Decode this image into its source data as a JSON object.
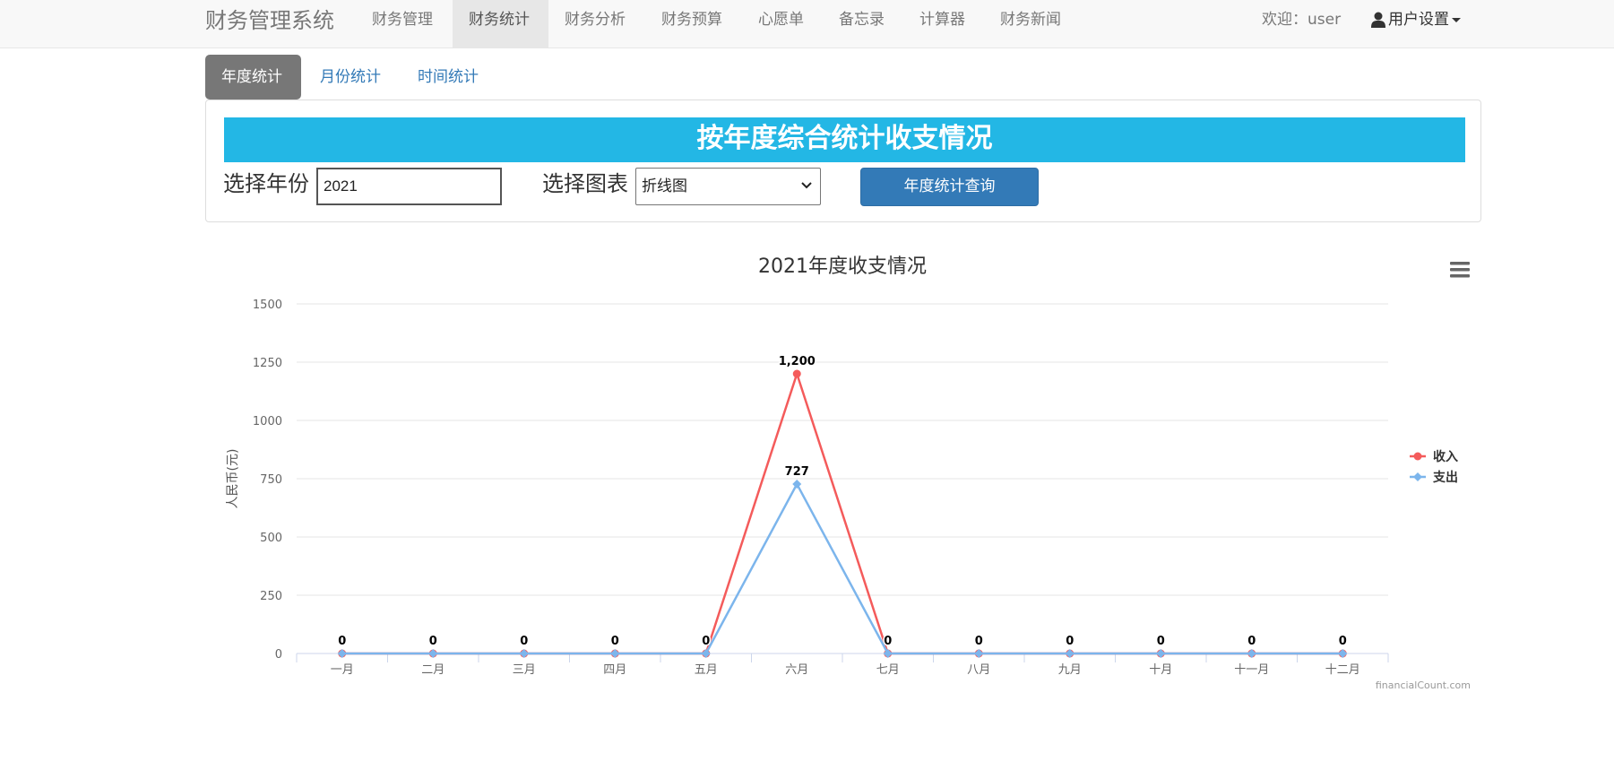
{
  "navbar": {
    "brand": "财务管理系统",
    "items": [
      {
        "label": "财务管理",
        "active": false
      },
      {
        "label": "财务统计",
        "active": true
      },
      {
        "label": "财务分析",
        "active": false
      },
      {
        "label": "财务预算",
        "active": false
      },
      {
        "label": "心愿单",
        "active": false
      },
      {
        "label": "备忘录",
        "active": false
      },
      {
        "label": "计算器",
        "active": false
      },
      {
        "label": "财务新闻",
        "active": false
      }
    ],
    "welcome": "欢迎：user",
    "user_settings": "用户设置"
  },
  "tabs": [
    {
      "label": "年度统计",
      "active": true
    },
    {
      "label": "月份统计",
      "active": false
    },
    {
      "label": "时间统计",
      "active": false
    }
  ],
  "panel": {
    "banner": "按年度综合统计收支情况",
    "year_label": "选择年份",
    "year_value": "2021",
    "chart_type_label": "选择图表",
    "chart_type_value": "折线图",
    "query_button": "年度统计查询"
  },
  "colors": {
    "income": "#f45b5b",
    "expense": "#7cb5ec",
    "accent": "#23b7e5",
    "button": "#337ab7"
  },
  "chart_data": {
    "type": "line",
    "title": "2021年度收支情况",
    "ylabel": "人民币(元)",
    "xlabel": "",
    "categories": [
      "一月",
      "二月",
      "三月",
      "四月",
      "五月",
      "六月",
      "七月",
      "八月",
      "九月",
      "十月",
      "十一月",
      "十二月"
    ],
    "yticks": [
      "0",
      "250",
      "500",
      "750",
      "1000",
      "1250",
      "1500"
    ],
    "ylim": [
      0,
      1500
    ],
    "series": [
      {
        "name": "收入",
        "values": [
          0,
          0,
          0,
          0,
          0,
          1200,
          0,
          0,
          0,
          0,
          0,
          0
        ],
        "labels": [
          "0",
          "0",
          "0",
          "0",
          "0",
          "1,200",
          "0",
          "0",
          "0",
          "0",
          "0",
          "0"
        ],
        "marker": "circle"
      },
      {
        "name": "支出",
        "values": [
          0,
          0,
          0,
          0,
          0,
          727,
          0,
          0,
          0,
          0,
          0,
          0
        ],
        "labels": [
          "",
          "",
          "",
          "",
          "",
          "727",
          "",
          "",
          "",
          "",
          "",
          ""
        ],
        "marker": "diamond"
      }
    ],
    "legend_position": "right",
    "grid": true,
    "credits": "financialCount.com",
    "menu_icon": "hamburger-menu-icon"
  }
}
